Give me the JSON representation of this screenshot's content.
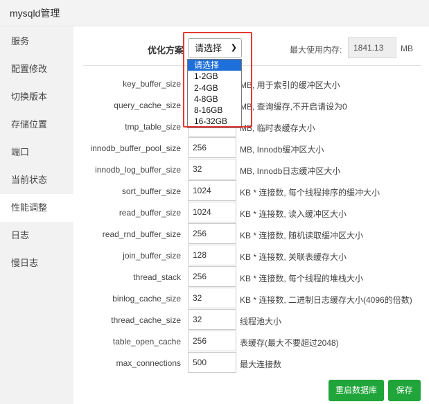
{
  "window": {
    "title": "mysqld管理"
  },
  "sidebar": {
    "items": [
      {
        "label": "服务"
      },
      {
        "label": "配置修改"
      },
      {
        "label": "切换版本"
      },
      {
        "label": "存储位置"
      },
      {
        "label": "端口"
      },
      {
        "label": "当前状态"
      },
      {
        "label": "性能调整",
        "active": true
      },
      {
        "label": "日志"
      },
      {
        "label": "慢日志"
      }
    ]
  },
  "header": {
    "opt_label": "优化方案",
    "select_value": "请选择",
    "mem_label": "最大使用内存:",
    "mem_value": "1841.13",
    "mem_unit": "MB"
  },
  "dropdown": {
    "options": [
      "请选择",
      "1-2GB",
      "2-4GB",
      "4-8GB",
      "8-16GB",
      "16-32GB"
    ],
    "selected": "请选择"
  },
  "rows": [
    {
      "label": "key_buffer_size",
      "value": "",
      "desc": "MB, 用于索引的缓冲区大小"
    },
    {
      "label": "query_cache_size",
      "value": "",
      "desc": "MB, 查询缓存,不开启请设为0"
    },
    {
      "label": "tmp_table_size",
      "value": "",
      "desc": "MB, 临时表缓存大小"
    },
    {
      "label": "innodb_buffer_pool_size",
      "value": "256",
      "desc": "MB, Innodb缓冲区大小"
    },
    {
      "label": "innodb_log_buffer_size",
      "value": "32",
      "desc": "MB, Innodb日志缓冲区大小"
    },
    {
      "label": "sort_buffer_size",
      "value": "1024",
      "desc": "KB * 连接数, 每个线程排序的缓冲大小"
    },
    {
      "label": "read_buffer_size",
      "value": "1024",
      "desc": "KB * 连接数, 读入缓冲区大小"
    },
    {
      "label": "read_rnd_buffer_size",
      "value": "256",
      "desc": "KB * 连接数, 随机读取缓冲区大小"
    },
    {
      "label": "join_buffer_size",
      "value": "128",
      "desc": "KB * 连接数, 关联表缓存大小"
    },
    {
      "label": "thread_stack",
      "value": "256",
      "desc": "KB * 连接数, 每个线程的堆栈大小"
    },
    {
      "label": "binlog_cache_size",
      "value": "32",
      "desc": "KB * 连接数, 二进制日志缓存大小(4096的倍数)"
    },
    {
      "label": "thread_cache_size",
      "value": "32",
      "desc": "线程池大小"
    },
    {
      "label": "table_open_cache",
      "value": "256",
      "desc": "表缓存(最大不要超过2048)"
    },
    {
      "label": "max_connections",
      "value": "500",
      "desc": "最大连接数"
    }
  ],
  "buttons": {
    "restart": "重启数据库",
    "save": "保存"
  },
  "colors": {
    "accent": "#20a53a",
    "highlight": "#e53935",
    "dropdown_selected": "#1e6fd9"
  }
}
